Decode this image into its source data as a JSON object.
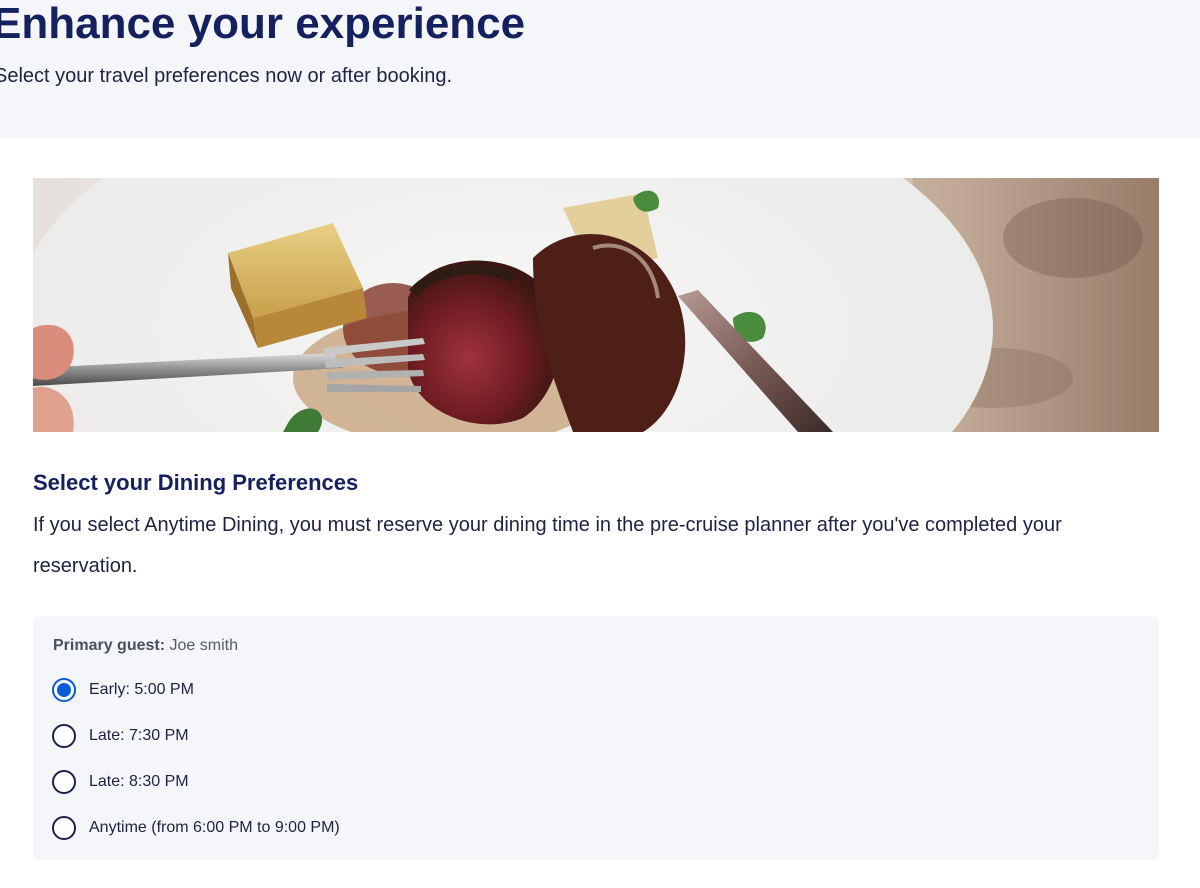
{
  "header": {
    "title": "Enhance your experience",
    "subtitle": "Select your travel preferences now or after booking."
  },
  "dining": {
    "heading": "Select your Dining Preferences",
    "description": "If you select Anytime Dining, you must reserve your dining time in the pre-cruise planner after you've completed your reservation.",
    "guest_label": "Primary guest:",
    "guest_name": "Joe smith",
    "options": [
      {
        "label": "Early: 5:00 PM",
        "selected": true
      },
      {
        "label": "Late: 7:30 PM",
        "selected": false
      },
      {
        "label": "Late: 8:30 PM",
        "selected": false
      },
      {
        "label": "Anytime (from 6:00 PM to 9:00 PM)",
        "selected": false
      }
    ]
  },
  "colors": {
    "heading": "#15205e",
    "accent": "#0a5bd7",
    "panel_bg": "#f4f6f9"
  }
}
